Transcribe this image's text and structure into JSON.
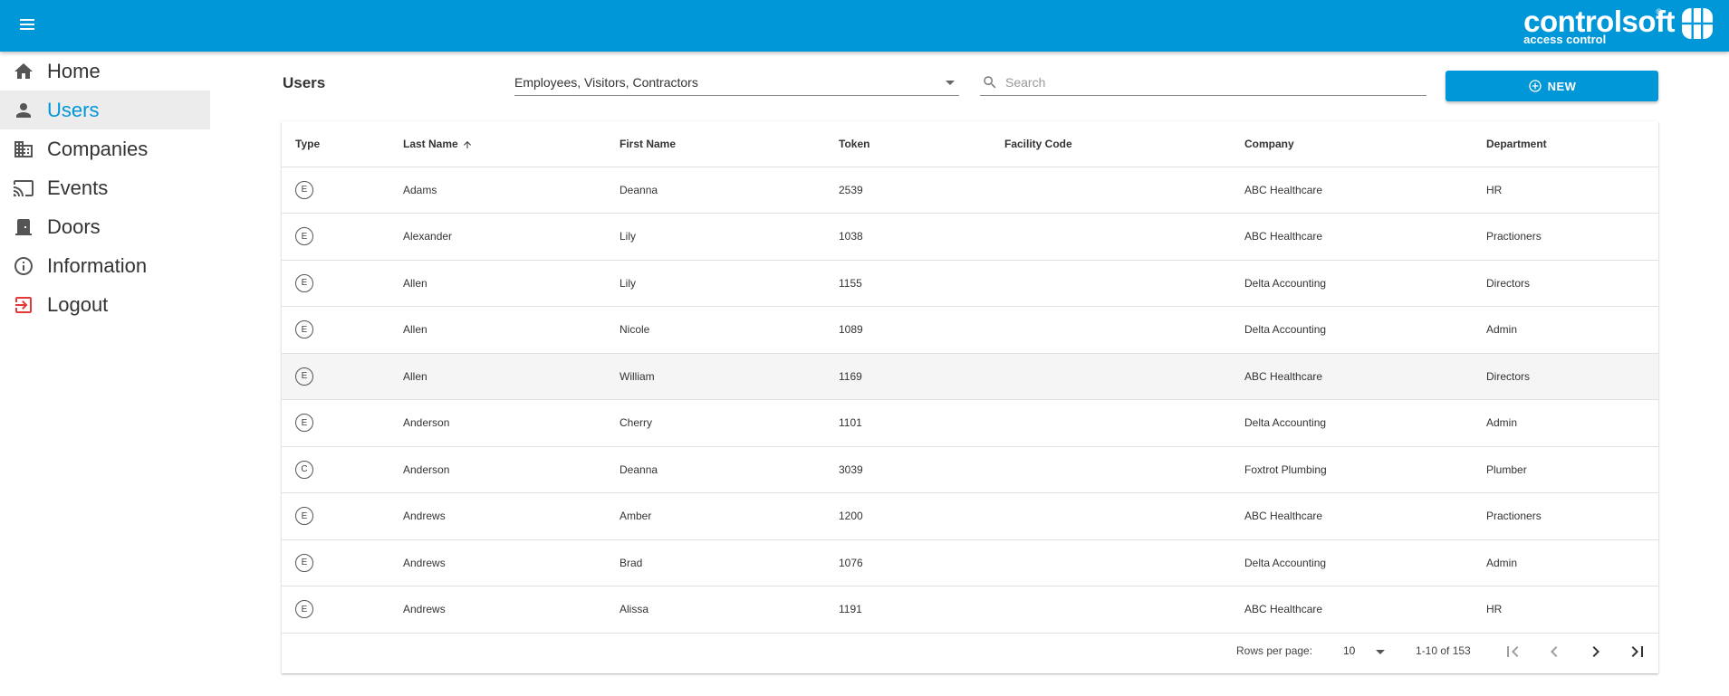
{
  "app": {
    "brand_name": "controlsoft",
    "brand_tagline": "access control",
    "brand_registered": "®",
    "colors": {
      "primary": "#0097d9",
      "logout": "#e53935",
      "selected_row": "#f5f5f5",
      "active_nav_bg": "#ececec"
    }
  },
  "header": {
    "menu_icon": "hamburger-menu-icon",
    "logo_icon": "controlsoft-grid-logo-icon"
  },
  "sidebar": {
    "items": [
      {
        "label": "Home",
        "icon": "home-icon"
      },
      {
        "label": "Users",
        "icon": "person-icon",
        "active": true
      },
      {
        "label": "Companies",
        "icon": "building-icon"
      },
      {
        "label": "Events",
        "icon": "cast-icon"
      },
      {
        "label": "Doors",
        "icon": "door-icon"
      },
      {
        "label": "Information",
        "icon": "info-icon"
      },
      {
        "label": "Logout",
        "icon": "logout-icon"
      }
    ]
  },
  "main": {
    "title": "Users",
    "filter": {
      "value": "Employees, Visitors, Contractors"
    },
    "search": {
      "placeholder": "Search",
      "value": ""
    },
    "new_button": "NEW"
  },
  "table": {
    "columns": [
      "Type",
      "Last Name",
      "First Name",
      "Token",
      "Facility Code",
      "Company",
      "Department"
    ],
    "sorted_column": "Last Name",
    "sort_direction": "ascending",
    "rows": [
      {
        "type": "E",
        "last": "Adams",
        "first": "Deanna",
        "token": "2539",
        "facility": "",
        "company": "ABC Healthcare",
        "dept": "HR"
      },
      {
        "type": "E",
        "last": "Alexander",
        "first": "Lily",
        "token": "1038",
        "facility": "",
        "company": "ABC Healthcare",
        "dept": "Practioners"
      },
      {
        "type": "E",
        "last": "Allen",
        "first": "Lily",
        "token": "1155",
        "facility": "",
        "company": "Delta Accounting",
        "dept": "Directors"
      },
      {
        "type": "E",
        "last": "Allen",
        "first": "Nicole",
        "token": "1089",
        "facility": "",
        "company": "Delta Accounting",
        "dept": "Admin"
      },
      {
        "type": "E",
        "last": "Allen",
        "first": "William",
        "token": "1169",
        "facility": "",
        "company": "ABC Healthcare",
        "dept": "Directors",
        "hovered": true
      },
      {
        "type": "E",
        "last": "Anderson",
        "first": "Cherry",
        "token": "1101",
        "facility": "",
        "company": "Delta Accounting",
        "dept": "Admin"
      },
      {
        "type": "C",
        "last": "Anderson",
        "first": "Deanna",
        "token": "3039",
        "facility": "",
        "company": "Foxtrot Plumbing",
        "dept": "Plumber"
      },
      {
        "type": "E",
        "last": "Andrews",
        "first": "Amber",
        "token": "1200",
        "facility": "",
        "company": "ABC Healthcare",
        "dept": "Practioners"
      },
      {
        "type": "E",
        "last": "Andrews",
        "first": "Brad",
        "token": "1076",
        "facility": "",
        "company": "Delta Accounting",
        "dept": "Admin"
      },
      {
        "type": "E",
        "last": "Andrews",
        "first": "Alissa",
        "token": "1191",
        "facility": "",
        "company": "ABC Healthcare",
        "dept": "HR"
      }
    ]
  },
  "pagination": {
    "rows_per_page_label": "Rows per page:",
    "rows_per_page": "10",
    "range": "1-10 of 153"
  }
}
